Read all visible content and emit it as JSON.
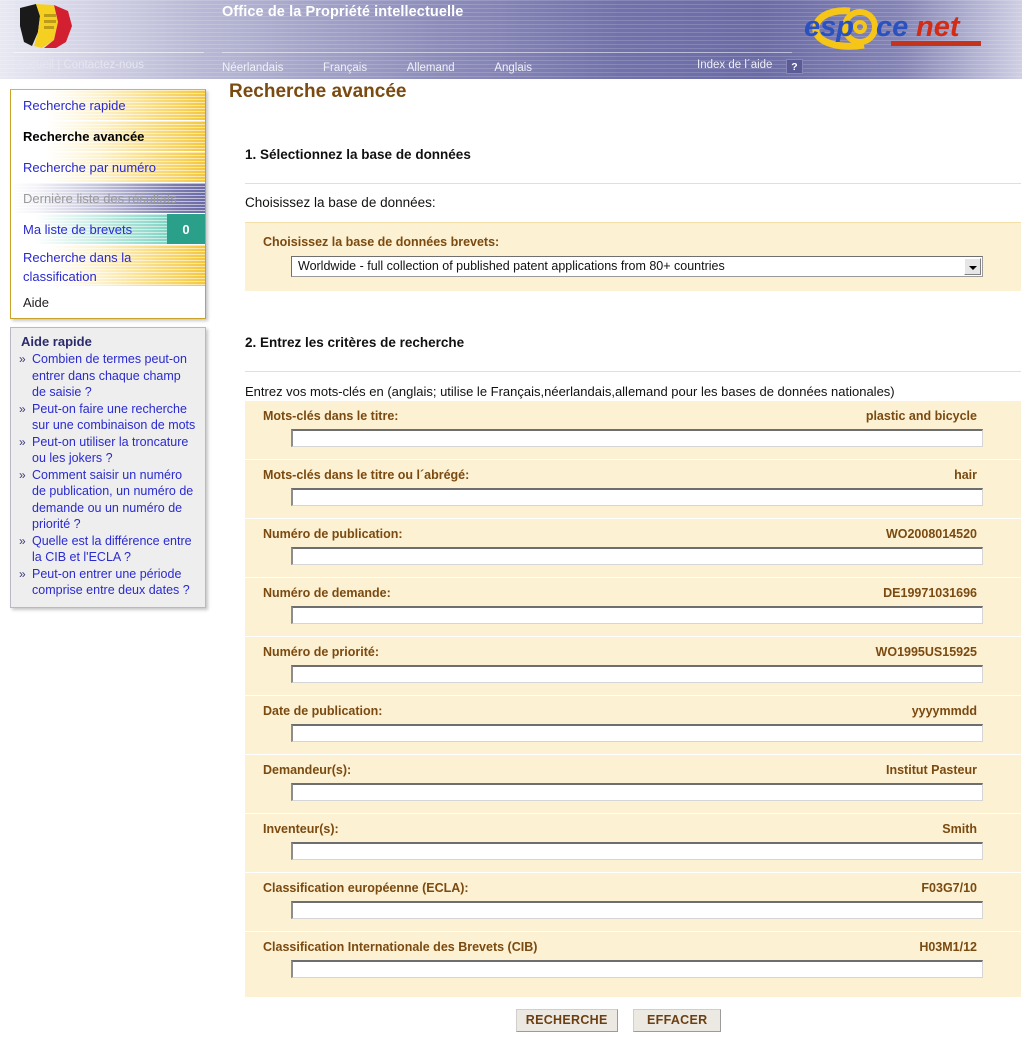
{
  "header": {
    "org_title": "Office de la Propriété intellectuelle",
    "logo_alt": "belgium-flag-map",
    "brand": {
      "part1": "esp",
      "at": "@",
      "part2": "ce",
      "part3": "net"
    },
    "utility_links": "Accueil | Contactez-nous",
    "languages": [
      {
        "label": "Néerlandais"
      },
      {
        "label": "Français"
      },
      {
        "label": "Allemand"
      },
      {
        "label": "Anglais"
      }
    ],
    "help_index_label": "Index de l´aide",
    "help_button_label": "?"
  },
  "sidebar": {
    "items": [
      {
        "label": "Recherche rapide",
        "state": "link"
      },
      {
        "label": "Recherche avancée",
        "state": "current"
      },
      {
        "label": "Recherche par numéro",
        "state": "link"
      },
      {
        "label": "Dernière liste des résultats",
        "state": "disabled"
      },
      {
        "label": "Ma liste de brevets",
        "state": "link",
        "badge": "0"
      },
      {
        "label": "Recherche dans la classification",
        "state": "link"
      },
      {
        "label": "Aide",
        "state": "plain"
      }
    ],
    "quick_help": {
      "title": "Aide rapide",
      "bullet": "»",
      "links": [
        "Combien de termes peut-on entrer dans chaque champ de saisie ?",
        "Peut-on faire une recherche sur une combinaison de mots",
        "Peut-on utiliser la troncature ou les jokers ?",
        "Comment saisir un numéro de publication, un numéro de demande ou un numéro de priorité ?",
        "Quelle est la différence entre la CIB et l'ECLA ?",
        "Peut-on entrer une période comprise entre deux dates ?"
      ]
    }
  },
  "main": {
    "page_title": "Recherche avancée",
    "step1": {
      "heading": "1. Sélectionnez la base de données",
      "intro": "Choisissez la base de données:",
      "panel_label": "Choisissez la base de données brevets:",
      "database_selected": "Worldwide - full collection of published patent applications from 80+ countries"
    },
    "step2": {
      "heading": "2. Entrez les critères de recherche",
      "intro": "Entrez vos mots-clés en (anglais; utilise le Français,néerlandais,allemand pour les bases de données nationales)",
      "fields": [
        {
          "label": "Mots-clés dans le titre:",
          "hint": "plastic and bicycle",
          "value": ""
        },
        {
          "label": "Mots-clés dans le titre ou l´abrégé:",
          "hint": "hair",
          "value": ""
        },
        {
          "label": "Numéro de publication:",
          "hint": "WO2008014520",
          "value": ""
        },
        {
          "label": "Numéro de demande:",
          "hint": "DE19971031696",
          "value": ""
        },
        {
          "label": "Numéro de priorité:",
          "hint": "WO1995US15925",
          "value": ""
        },
        {
          "label": "Date de publication:",
          "hint": "yyyymmdd",
          "value": ""
        },
        {
          "label": "Demandeur(s):",
          "hint": "Institut Pasteur",
          "value": ""
        },
        {
          "label": "Inventeur(s):",
          "hint": "Smith",
          "value": ""
        },
        {
          "label": "Classification européenne (ECLA):",
          "hint": "F03G7/10",
          "value": ""
        },
        {
          "label": "Classification Internationale des Brevets (CIB)",
          "hint": "H03M1/12",
          "value": ""
        }
      ]
    },
    "actions": {
      "search_label": "RECHERCHE",
      "clear_label": "EFFACER"
    }
  },
  "colors": {
    "header_purple": "#7272ab",
    "nav_gold": "#f3c63d",
    "panel_cream": "#fdf1d4",
    "label_brown": "#7a4a10",
    "link_blue": "#2a2ad0",
    "badge_teal": "#2aa08a",
    "button_face": "#ece9e2"
  }
}
